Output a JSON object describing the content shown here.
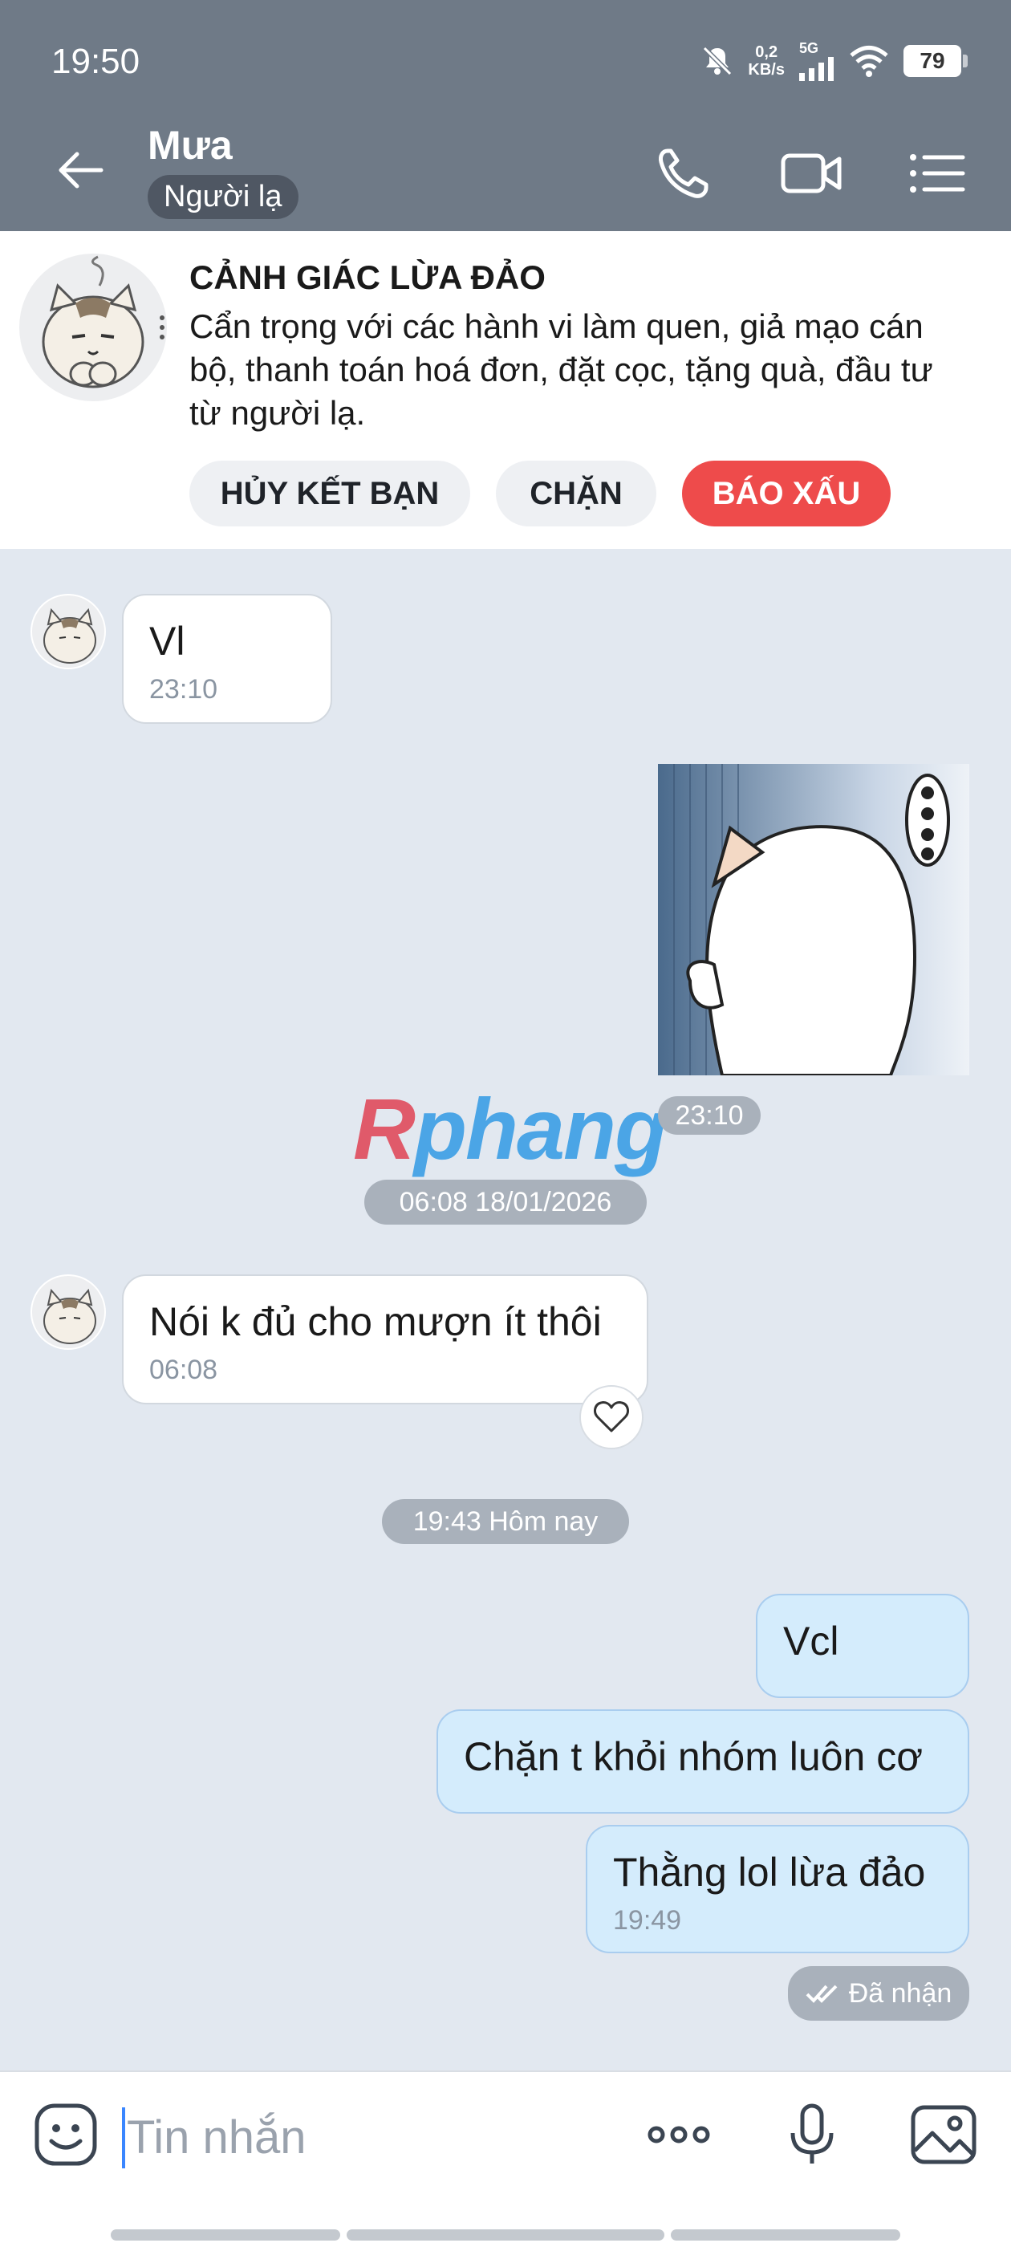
{
  "status_bar": {
    "time": "19:50",
    "net_speed_value": "0,2",
    "net_speed_unit": "KB/s",
    "network": "5G",
    "battery": "79",
    "icons": [
      "bell-muted-icon",
      "signal-icon",
      "wifi-icon",
      "battery-icon"
    ]
  },
  "header": {
    "contact_name": "Mưa",
    "contact_tag": "Người lạ",
    "icons": [
      "back-arrow-icon",
      "phone-icon",
      "video-call-icon",
      "menu-list-icon"
    ]
  },
  "warning": {
    "title": "CẢNH GIÁC LỪA ĐẢO",
    "text": "Cẩn trọng với các hành vi làm quen, giả mạo cán bộ, thanh toán hoá đơn, đặt cọc, tặng quà, đầu tư từ người lạ.",
    "buttons": {
      "unfriend": "HỦY KẾT BẠN",
      "block": "CHẶN",
      "report": "BÁO XẤU"
    },
    "colors": {
      "report": "#ee4b4b"
    }
  },
  "messages": {
    "m1": {
      "text": "Vl",
      "time": "23:10"
    },
    "sticker_time": "23:10",
    "date_sep_1": "06:08 18/01/2026",
    "m2": {
      "text": "Nói k đủ cho mượn ít thôi",
      "time": "06:08"
    },
    "date_sep_2": "19:43 Hôm nay",
    "m3": {
      "text": "Vcl"
    },
    "m4": {
      "text": "Chặn t khỏi nhóm luôn cơ"
    },
    "m5": {
      "text": "Thằng lol lừa đảo",
      "time": "19:49"
    },
    "status": "Đã nhận"
  },
  "watermark": {
    "first": "R",
    "rest": "phang"
  },
  "composer": {
    "placeholder": "Tin nhắn",
    "icons": [
      "emoji-icon",
      "more-dots-icon",
      "microphone-icon",
      "image-icon"
    ]
  },
  "colors": {
    "topbar": "#6f7a87",
    "chat_bg": "#e2e8f0",
    "outgoing_bubble": "#d4ecfc"
  }
}
